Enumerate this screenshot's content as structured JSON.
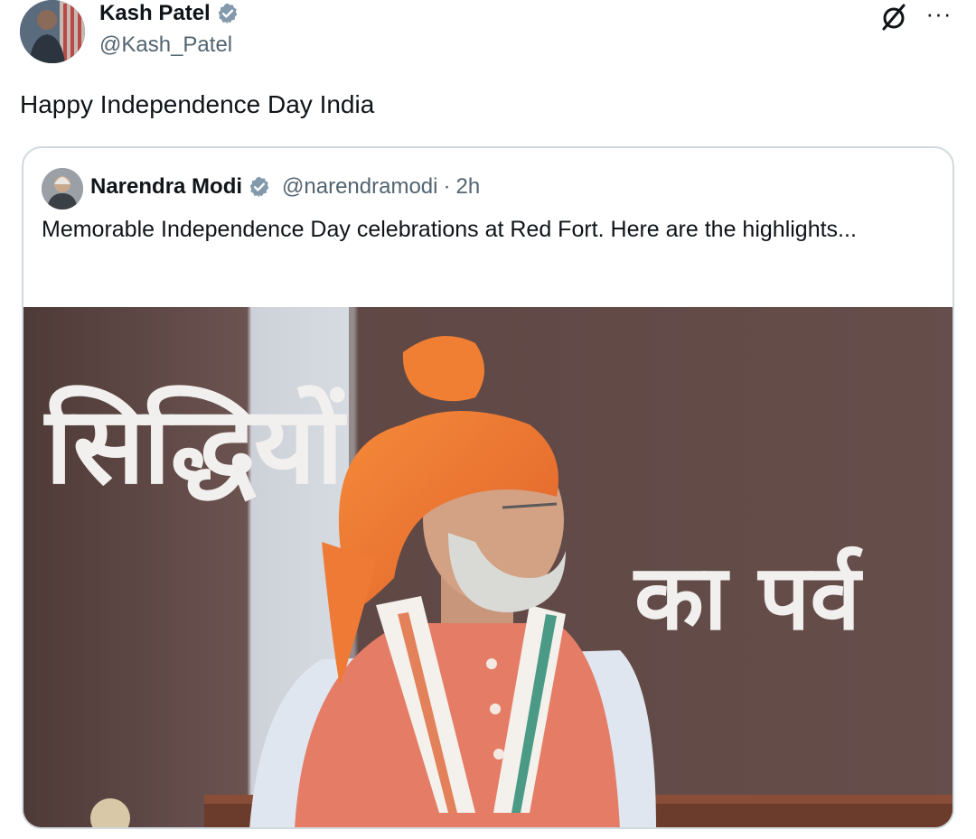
{
  "author": {
    "name": "Kash Patel",
    "handle": "@Kash_Patel",
    "verified": true,
    "avatar_icon": "profile-photo"
  },
  "post": {
    "text": "Happy Independence Day India"
  },
  "actions": {
    "grok_icon": "grok-icon",
    "more_icon": "more-horizontal-icon",
    "more_glyph": "···"
  },
  "quoted_post": {
    "name": "Narendra Modi",
    "handle": "@narendramodi",
    "separator": "·",
    "time": "2h",
    "verified": true,
    "text": "Memorable Independence Day celebrations at Red Fort. Here are the highlights...",
    "media": {
      "overlay_line_1": "सिद्धियों",
      "overlay_line_2": "का पर्व"
    }
  },
  "colors": {
    "verified_blue": "#1d9bf0",
    "secondary_text": "#536471",
    "border": "#cfd9de",
    "turban_orange": "#f07a2a",
    "vest_orange": "#e9826a"
  }
}
